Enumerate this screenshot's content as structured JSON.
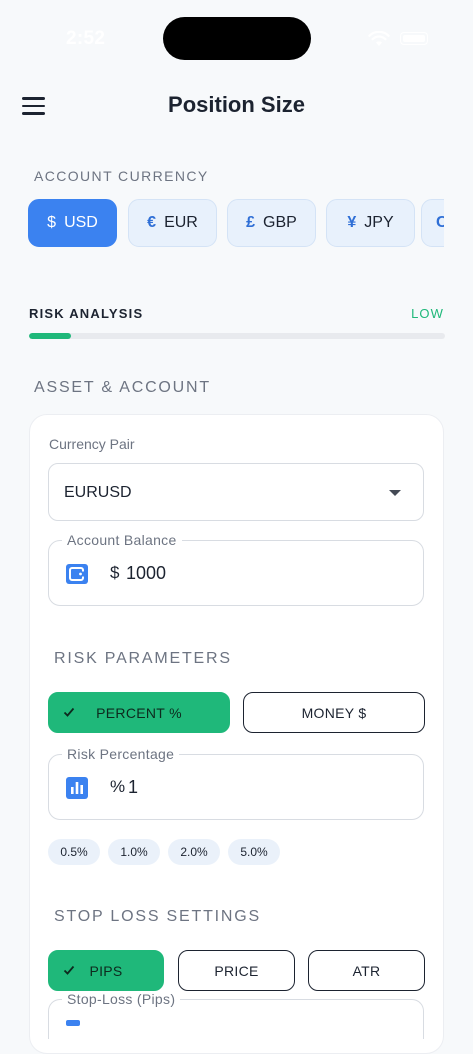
{
  "status_bar": {
    "time": "2:52"
  },
  "header": {
    "title": "Position Size"
  },
  "account_currency": {
    "label": "ACCOUNT CURRENCY",
    "chips": [
      {
        "symbol": "$",
        "code": "USD",
        "active": true
      },
      {
        "symbol": "€",
        "code": "EUR",
        "active": false
      },
      {
        "symbol": "£",
        "code": "GBP",
        "active": false
      },
      {
        "symbol": "¥",
        "code": "JPY",
        "active": false
      },
      {
        "symbol": "C",
        "code": "",
        "active": false
      }
    ]
  },
  "risk_analysis": {
    "label": "RISK ANALYSIS",
    "level": "LOW",
    "level_fraction": 0.1,
    "color": "#1fb87a"
  },
  "asset_account": {
    "section_label": "ASSET & ACCOUNT",
    "currency_pair_label": "Currency Pair",
    "currency_pair_value": "EURUSD",
    "balance_label": "Account Balance",
    "balance_prefix": "$",
    "balance_value": "1000"
  },
  "risk_parameters": {
    "section_label": "RISK PARAMETERS",
    "percent_label": "PERCENT %",
    "money_label": "MONEY $",
    "risk_pct_label": "Risk Percentage",
    "risk_pct_prefix": "%",
    "risk_pct_value": "1",
    "presets": [
      "0.5%",
      "1.0%",
      "2.0%",
      "5.0%"
    ]
  },
  "stop_loss": {
    "section_label": "STOP LOSS SETTINGS",
    "pips_label": "PIPS",
    "price_label": "PRICE",
    "atr_label": "ATR",
    "field_label": "Stop-Loss (Pips)"
  },
  "colors": {
    "accent_blue": "#3b82f0",
    "accent_green": "#1fb87a",
    "text": "#1c2330"
  }
}
